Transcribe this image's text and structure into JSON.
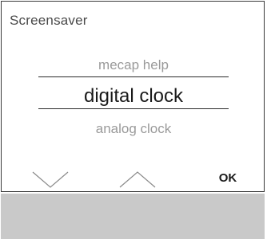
{
  "screen": {
    "title": "Screensaver"
  },
  "picker": {
    "previous": "mecap help",
    "selected": "digital clock",
    "next": "analog clock"
  },
  "buttons": {
    "down_icon": "chevron-down-icon",
    "up_icon": "chevron-up-icon",
    "ok_label": "OK"
  },
  "colors": {
    "footer": "#c9c9c9",
    "border": "#3a3a3a"
  }
}
